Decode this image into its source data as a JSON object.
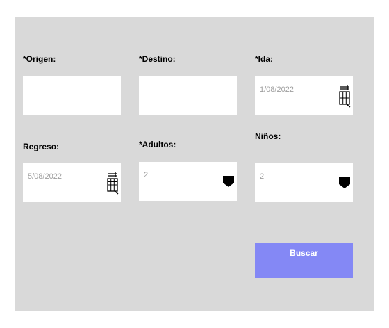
{
  "form": {
    "origen": {
      "label": "*Origen:",
      "value": ""
    },
    "destino": {
      "label": "*Destino:",
      "value": ""
    },
    "ida": {
      "label": "*Ida:",
      "value": "1/08/2022",
      "icon": "calendar-icon"
    },
    "regreso": {
      "label": "Regreso:",
      "value": "5/08/2022",
      "icon": "calendar-icon"
    },
    "adultos": {
      "label": "*Adultos:",
      "value": "2",
      "icon": "caret-down-icon"
    },
    "ninos": {
      "label": "Niños:",
      "value": "2",
      "icon": "caret-down-icon"
    },
    "buscar_label": "Buscar"
  },
  "colors": {
    "panel_bg": "#d9d9d9",
    "field_bg": "#ffffff",
    "placeholder_text": "#9e9e9e",
    "button_bg": "#8488f5",
    "button_text": "#ffffff"
  }
}
